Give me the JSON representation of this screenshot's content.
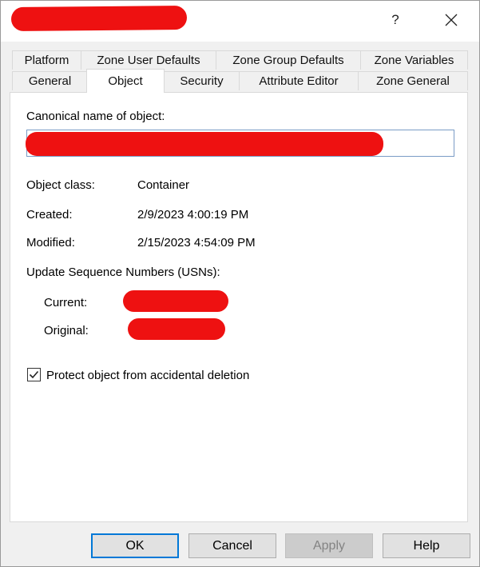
{
  "window": {
    "help_glyph": "?",
    "close_glyph": "✕"
  },
  "tabs": {
    "row1": [
      "Platform",
      "Zone User Defaults",
      "Zone Group Defaults",
      "Zone Variables"
    ],
    "row2": [
      "General",
      "Object",
      "Security",
      "Attribute Editor",
      "Zone General"
    ],
    "active": "Object"
  },
  "object": {
    "canonical_label": "Canonical name of object:",
    "object_class_label": "Object class:",
    "object_class_value": "Container",
    "created_label": "Created:",
    "created_value": "2/9/2023 4:00:19 PM",
    "modified_label": "Modified:",
    "modified_value": "2/15/2023 4:54:09 PM",
    "usn_label": "Update Sequence Numbers (USNs):",
    "current_label": "Current:",
    "original_label": "Original:",
    "protect_label": "Protect object from accidental deletion",
    "protect_checked": true
  },
  "buttons": {
    "ok": "OK",
    "cancel": "Cancel",
    "apply": "Apply",
    "help": "Help"
  },
  "colors": {
    "redaction": "#ee1111",
    "focus_border": "#0078d7"
  }
}
